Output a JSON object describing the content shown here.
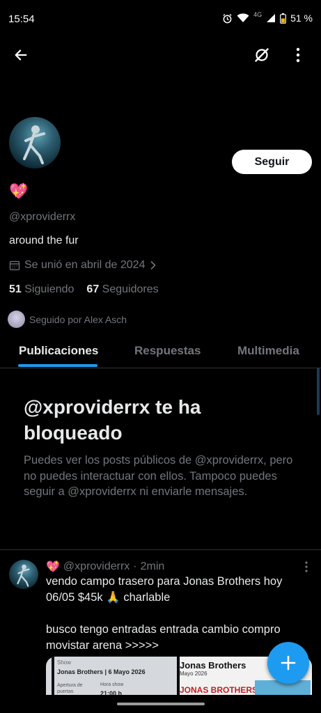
{
  "status_bar": {
    "time": "15:54",
    "network": "4G",
    "battery": "51 %"
  },
  "toolbar": {
    "back_icon": "arrow-left-icon",
    "grok_icon": "slash-circle-icon",
    "more_icon": "more-vertical-icon"
  },
  "profile": {
    "name_emoji": "💖",
    "follow_label": "Seguir",
    "handle": "@xproviderrx",
    "bio": "around the fur",
    "joined": "Se unió en abril de 2024",
    "following_count": "51",
    "following_label": "Siguiendo",
    "followers_count": "67",
    "followers_label": "Seguidores",
    "followed_by": "Seguido por Alex Asch"
  },
  "tabs": [
    {
      "label": "Publicaciones",
      "active": true
    },
    {
      "label": "Respuestas",
      "active": false
    },
    {
      "label": "Multimedia",
      "active": false
    }
  ],
  "blocked": {
    "title": "@xproviderrx te ha bloqueado",
    "text": "Puedes ver los posts públicos de @xproviderrx, pero no puedes interactuar con ellos. Tampoco puedes seguir a @xproviderrx ni enviarle mensajes."
  },
  "post": {
    "emoji": "💖",
    "handle": "@xproviderrx",
    "separator": "·",
    "time": "2min",
    "text": "vendo campo trasero para Jonas Brothers hoy 06/05 $45k 🙏 charlable\n\nbusco tengo entradas entrada cambio compro movistar arena >>>>>",
    "media": {
      "left_label": "Show",
      "left_title": "Jonas Brothers | 6 Mayo 2026",
      "left_col1": "Apertura de puertas",
      "left_col2": "Hora show",
      "left_value": "21:00 h",
      "right_title": "Jonas Brothers",
      "right_sub": "Mayo 2026",
      "right_banner": "JONAS BROTHERS"
    }
  },
  "colors": {
    "accent": "#1d9bf0",
    "background": "#000000",
    "muted": "#71767b",
    "text": "#e7e9ea"
  }
}
